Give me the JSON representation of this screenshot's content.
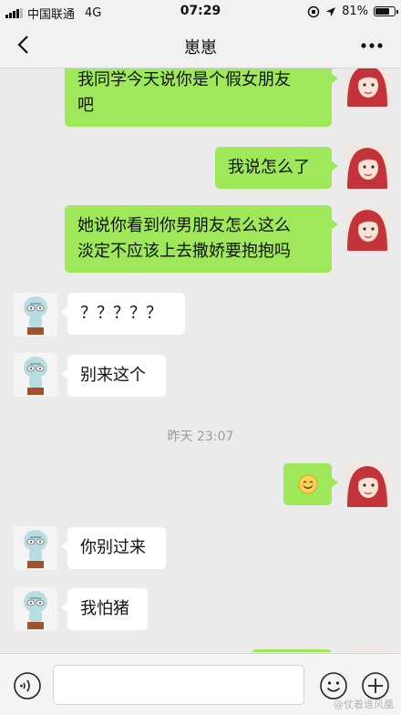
{
  "status_bar": {
    "carrier": "中国联通",
    "network": "4G",
    "time": "07:29",
    "battery": "81%",
    "battery_level": 0.81
  },
  "header": {
    "title": "崽崽",
    "back_icon": "chevron-left-icon",
    "more_icon": "ellipsis-icon"
  },
  "messages": [
    {
      "sender": "me",
      "text_lines": [
        "我同学今天说你是个假女朋友",
        "吧"
      ]
    },
    {
      "sender": "me",
      "text_lines": [
        "我说怎么了"
      ]
    },
    {
      "sender": "me",
      "text_lines": [
        "她说你看到你男朋友怎么这么",
        "淡定不应该上去撒娇要抱抱吗"
      ]
    },
    {
      "sender": "them",
      "text_lines": [
        "？？？？？"
      ]
    },
    {
      "sender": "them",
      "text_lines": [
        "别来这个"
      ]
    },
    {
      "type": "timestamp",
      "text": "昨天 23:07"
    },
    {
      "sender": "me",
      "emoji": "smile-emoji"
    },
    {
      "sender": "them",
      "text_lines": [
        "你别过来"
      ]
    },
    {
      "sender": "them",
      "text_lines": [
        "我怕猪"
      ]
    }
  ],
  "input_bar": {
    "value": "",
    "voice_icon": "voice-icon",
    "emoji_icon": "emoji-icon",
    "plus_icon": "plus-icon"
  },
  "watermark": "@仗着谁风凰"
}
